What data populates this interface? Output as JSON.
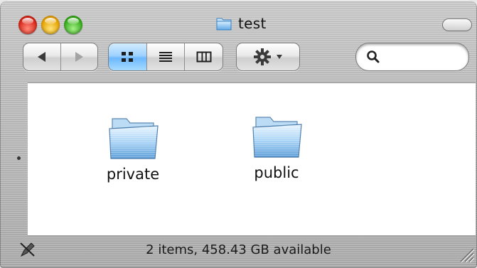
{
  "window": {
    "title": "test",
    "title_icon": "folder-icon"
  },
  "toolbar": {
    "back_icon": "back-arrow-icon",
    "forward_icon": "forward-arrow-icon",
    "view_modes": [
      {
        "name": "icon-view",
        "icon": "icon-view-icon",
        "selected": true
      },
      {
        "name": "list-view",
        "icon": "list-view-icon",
        "selected": false
      },
      {
        "name": "column-view",
        "icon": "column-view-icon",
        "selected": false
      }
    ],
    "action_icon": "gear-icon",
    "search_icon": "search-icon",
    "search_value": ""
  },
  "content": {
    "items": [
      {
        "label": "private",
        "icon": "folder-icon"
      },
      {
        "label": "public",
        "icon": "folder-icon"
      }
    ]
  },
  "status": {
    "text": "2 items, 458.43 GB available"
  },
  "colors": {
    "selected_segment": "#8cc8ff",
    "close": "#d8281a",
    "minimize": "#e6a300",
    "zoom": "#38ad1d"
  }
}
